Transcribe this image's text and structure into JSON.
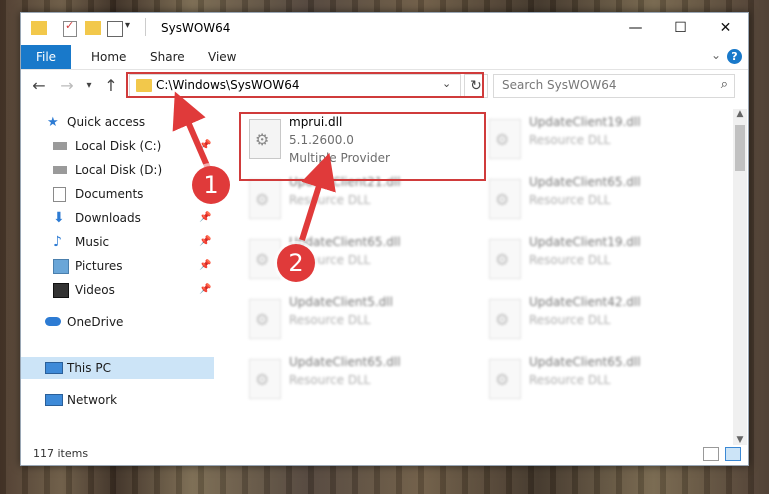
{
  "window": {
    "title": "SysWOW64",
    "tabs": [
      "File",
      "Home",
      "Share",
      "View"
    ]
  },
  "navbar": {
    "address": "C:\\Windows\\SysWOW64",
    "search_placeholder": "Search SysWOW64"
  },
  "sidebar": {
    "items": [
      {
        "label": "Quick access",
        "icon": "star-icon"
      },
      {
        "label": "Local Disk (C:)",
        "icon": "drive-icon"
      },
      {
        "label": "Local Disk (D:)",
        "icon": "drive-icon"
      },
      {
        "label": "Documents",
        "icon": "documents-icon"
      },
      {
        "label": "Downloads",
        "icon": "downloads-icon"
      },
      {
        "label": "Music",
        "icon": "music-icon"
      },
      {
        "label": "Pictures",
        "icon": "pictures-icon"
      },
      {
        "label": "Videos",
        "icon": "videos-icon"
      },
      {
        "label": "OneDrive",
        "icon": "cloud-icon"
      },
      {
        "label": "This PC",
        "icon": "pc-icon"
      },
      {
        "label": "Network",
        "icon": "network-icon"
      }
    ]
  },
  "files": [
    {
      "name": "mprui.dll",
      "version": "5.1.2600.0",
      "company": "Multiple Provider"
    },
    {
      "name": "UpdateClient19.dll",
      "type": "Resource DLL"
    },
    {
      "name": "UpdateClient21.dll",
      "type": "Resource DLL"
    },
    {
      "name": "UpdateClient65.dll",
      "type": "Resource DLL"
    },
    {
      "name": "UpdateClient65.dll",
      "type": "Resource DLL"
    },
    {
      "name": "UpdateClient19.dll",
      "type": "Resource DLL"
    },
    {
      "name": "UpdateClient5.dll",
      "type": "Resource DLL"
    },
    {
      "name": "UpdateClient42.dll",
      "type": "Resource DLL"
    },
    {
      "name": "UpdateClient65.dll",
      "type": "Resource DLL"
    },
    {
      "name": "UpdateClient65.dll",
      "type": "Resource DLL"
    }
  ],
  "status": {
    "items_count": "117 items"
  },
  "annotations": {
    "step1": "1",
    "step2": "2",
    "color": "#d03b3b"
  }
}
